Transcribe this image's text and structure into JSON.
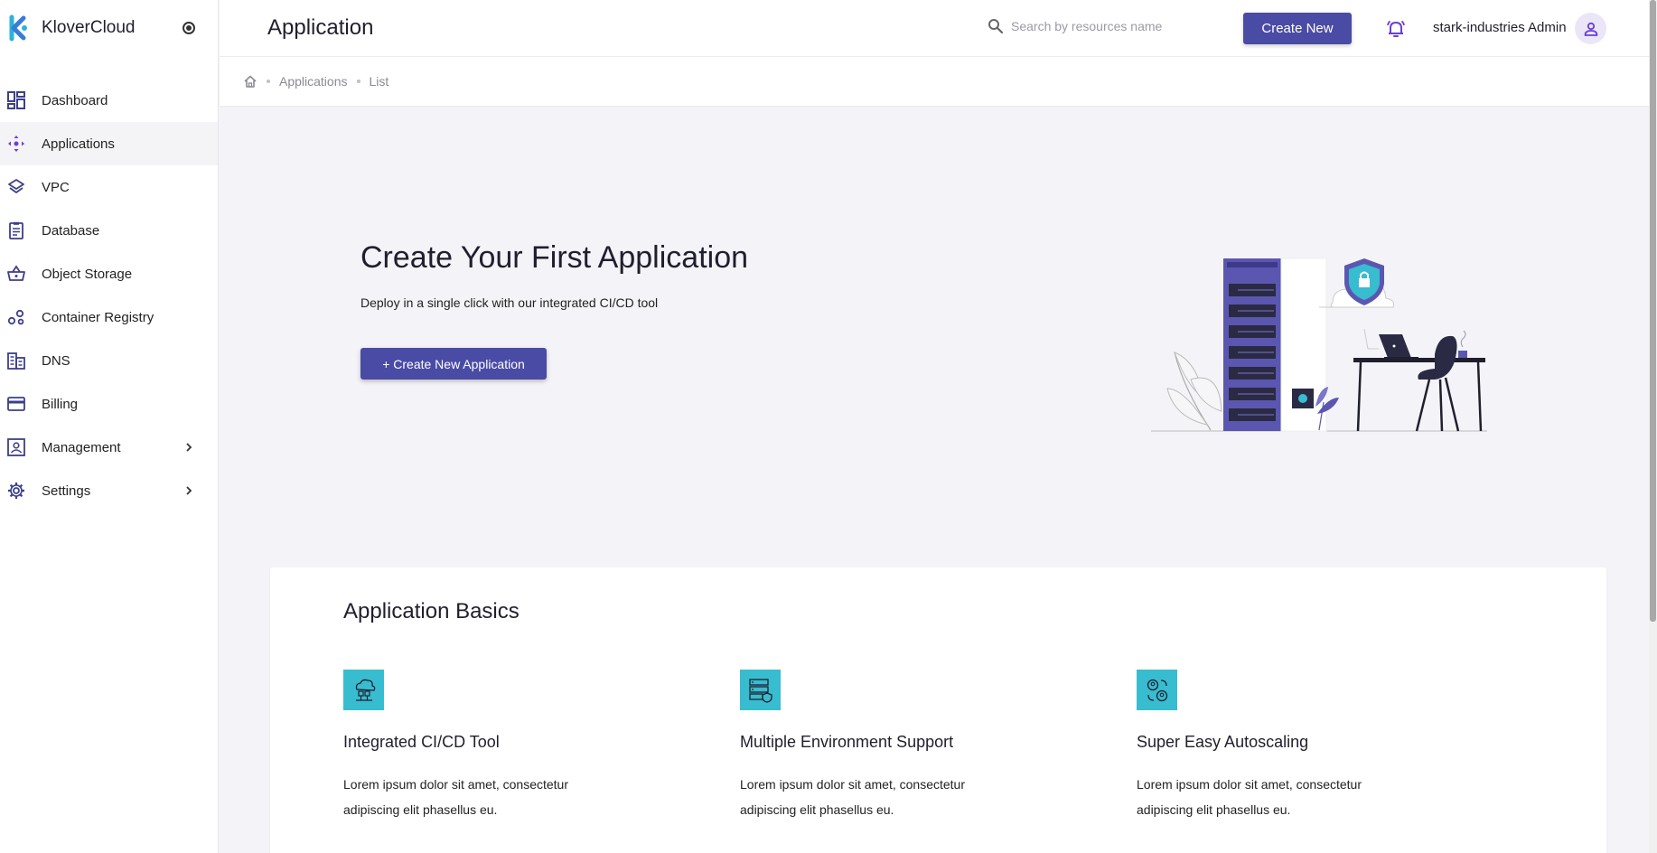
{
  "app": {
    "brand_name": "KloverCloud",
    "brand_color": "#4a4ba5",
    "accent_color": "#38bcd0"
  },
  "sidebar": {
    "items": [
      {
        "label": "Dashboard",
        "icon": "dashboard-icon"
      },
      {
        "label": "Applications",
        "icon": "applications-icon",
        "active": true
      },
      {
        "label": "VPC",
        "icon": "layers-icon"
      },
      {
        "label": "Database",
        "icon": "database-icon"
      },
      {
        "label": "Object Storage",
        "icon": "basket-icon"
      },
      {
        "label": "Container Registry",
        "icon": "registry-icon"
      },
      {
        "label": "DNS",
        "icon": "dns-icon"
      },
      {
        "label": "Billing",
        "icon": "credit-card-icon"
      },
      {
        "label": "Management",
        "icon": "management-icon",
        "expandable": true
      },
      {
        "label": "Settings",
        "icon": "gear-icon",
        "expandable": true
      }
    ]
  },
  "header": {
    "title": "Application",
    "search_placeholder": "Search by resources name",
    "create_button": "Create New",
    "user_name": "stark-industries Admin"
  },
  "breadcrumb": {
    "items": [
      "Applications",
      "List"
    ]
  },
  "hero": {
    "title": "Create Your First Application",
    "subtitle": "Deploy in a single click with our integrated CI/CD tool",
    "button": "+ Create New Application"
  },
  "basics": {
    "title": "Application Basics",
    "features": [
      {
        "title": "Integrated CI/CD Tool",
        "text": "Lorem ipsum dolor sit amet, consectetur adipiscing elit phasellus eu.",
        "icon": "cloud-network-icon"
      },
      {
        "title": "Multiple Environment Support",
        "text": "Lorem ipsum dolor sit amet, consectetur adipiscing elit phasellus eu.",
        "icon": "server-shield-icon"
      },
      {
        "title": "Super Easy Autoscaling",
        "text": "Lorem ipsum dolor sit amet, consectetur adipiscing elit phasellus eu.",
        "icon": "users-sync-icon"
      }
    ]
  }
}
